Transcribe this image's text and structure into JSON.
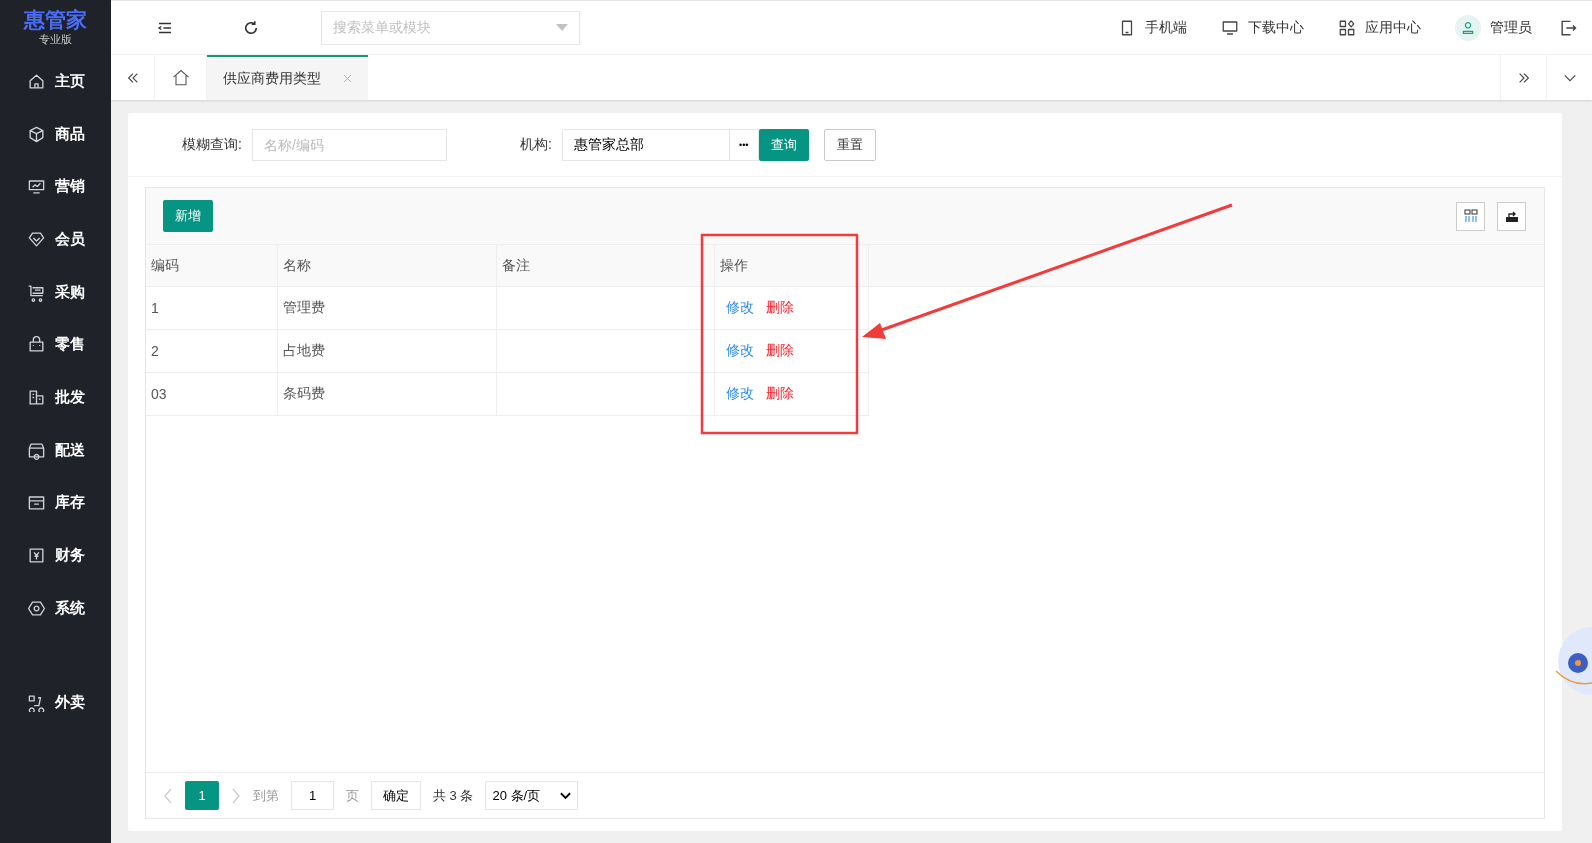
{
  "logo": {
    "name": "惠管家",
    "edition": "专业版"
  },
  "sidebar": {
    "items": [
      {
        "label": "主页"
      },
      {
        "label": "商品"
      },
      {
        "label": "营销"
      },
      {
        "label": "会员"
      },
      {
        "label": "采购"
      },
      {
        "label": "零售"
      },
      {
        "label": "批发"
      },
      {
        "label": "配送"
      },
      {
        "label": "库存"
      },
      {
        "label": "财务"
      },
      {
        "label": "系统"
      },
      {
        "label": "外卖"
      }
    ]
  },
  "topbar": {
    "search": {
      "placeholder": "搜索菜单或模块"
    },
    "links": [
      {
        "label": "手机端"
      },
      {
        "label": "下载中心"
      },
      {
        "label": "应用中心"
      },
      {
        "label": "管理员"
      }
    ]
  },
  "tabs": [
    {
      "label": "供应商费用类型",
      "selected": true
    }
  ],
  "filter": {
    "keyword": {
      "label": "模糊查询:",
      "placeholder": "名称/编码"
    },
    "org": {
      "label": "机构:",
      "value": "惠管家总部",
      "more": "•••"
    },
    "buttons": [
      "查询",
      "重置"
    ]
  },
  "toolbar": {
    "add": "新增"
  },
  "table": {
    "columns": [
      "编码",
      "名称",
      "备注",
      "操作"
    ],
    "rows": [
      {
        "code": "1",
        "name": "管理费",
        "actions": [
          "修改",
          "删除"
        ]
      },
      {
        "code": "2",
        "name": "占地费",
        "actions": [
          "修改",
          "删除"
        ]
      },
      {
        "code": "03",
        "name": "条码费",
        "actions": [
          "修改",
          "删除"
        ]
      }
    ]
  },
  "pagination": {
    "pages": [
      {
        "label": "1",
        "selected": true
      }
    ],
    "goto_label": "到第",
    "goto_value": "1",
    "page_label": "页",
    "confirm": "确定",
    "total": "共 3 条",
    "page_size": "20 条/页"
  }
}
